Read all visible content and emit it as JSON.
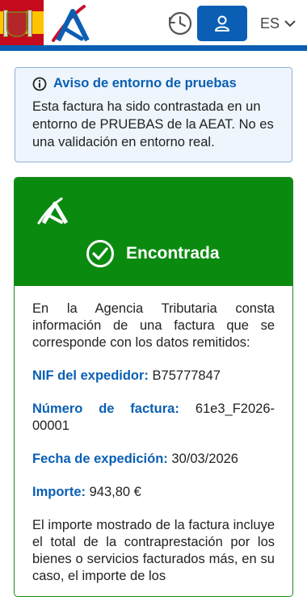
{
  "header": {
    "language": "ES",
    "icons": [
      "spain-flag-icon",
      "aeat-logo-icon",
      "clock-icon",
      "user-icon",
      "chevron-down-icon"
    ],
    "colors": {
      "brand_blue": "#0a5fb4",
      "header_bar": "#0a5fb4"
    }
  },
  "notice": {
    "title": "Aviso de entorno de pruebas",
    "text": "Esta factura ha sido contrastada en un entorno de PRUEBAS de la AEAT. No es una validación en entorno real.",
    "colors": {
      "background": "#eef5fc",
      "border": "#8fb4d8"
    }
  },
  "result": {
    "status": "Encontrada",
    "status_color": "#0b8a10",
    "intro": "En la Agencia Tributaria consta información de una factura que se corresponde con los datos remitidos:",
    "fields": {
      "nif_label": "NIF del expedidor:",
      "nif_value": "B75777847",
      "invoice_label_1": "Número",
      "invoice_label_2": "de",
      "invoice_label_3": "factura:",
      "invoice_value_1": "61e3_F2026-",
      "invoice_value_2": "00001",
      "date_label": "Fecha de expedición:",
      "date_value": "30/03/2026",
      "amount_label": "Importe:",
      "amount_value": "943,80 €"
    },
    "footer_text": "El importe mostrado de la factura incluye el total de la contraprestación por los bienes o servicios facturados más, en su caso, el importe de los"
  }
}
